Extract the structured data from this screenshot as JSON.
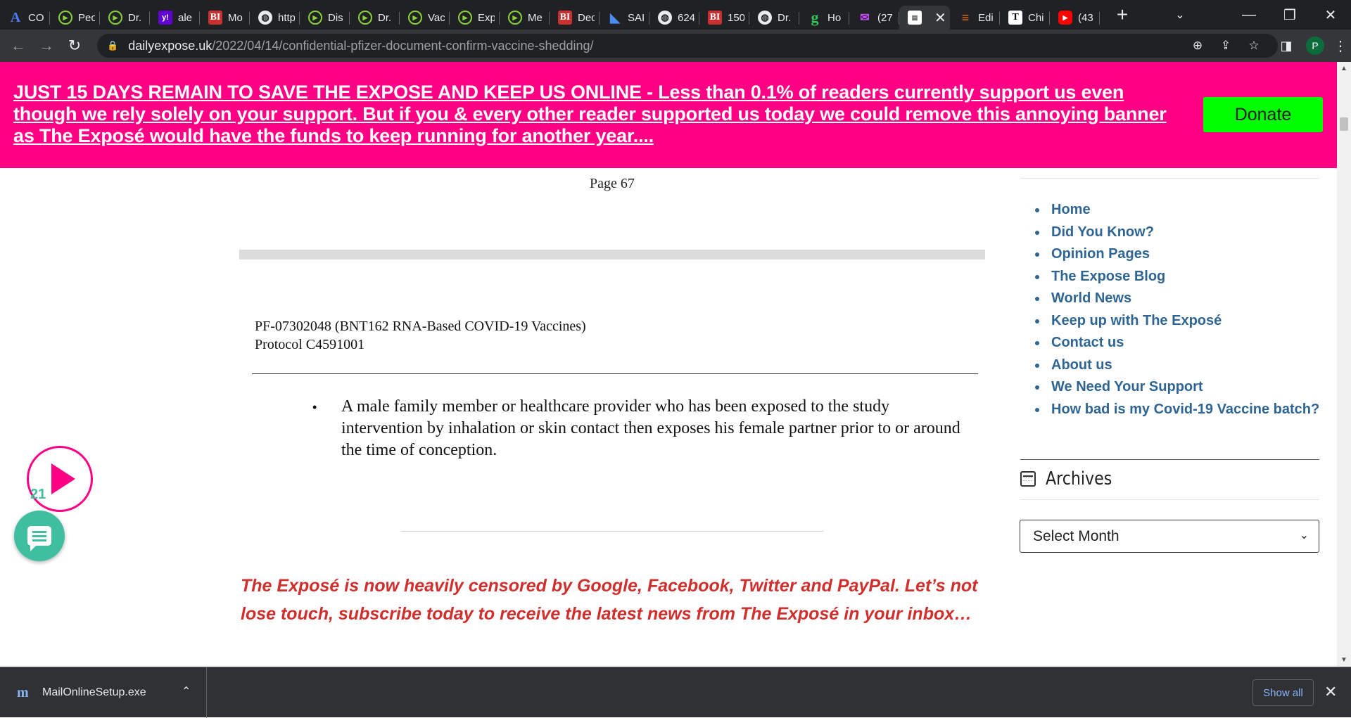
{
  "tabs": [
    {
      "label": "CO",
      "icon": "atlas-icon",
      "glyph": "A"
    },
    {
      "label": "Peo",
      "icon": "play-icon",
      "glyph": "▶"
    },
    {
      "label": "Dr.",
      "icon": "play-icon",
      "glyph": "▶"
    },
    {
      "label": "ale",
      "icon": "yahoo-icon",
      "glyph": "y!"
    },
    {
      "label": "Mo",
      "icon": "bi-icon",
      "glyph": "BI"
    },
    {
      "label": "http",
      "icon": "globe-icon",
      "glyph": "◍"
    },
    {
      "label": "Dis",
      "icon": "play-icon",
      "glyph": "▶"
    },
    {
      "label": "Dr.",
      "icon": "play-icon",
      "glyph": "▶"
    },
    {
      "label": "Vac",
      "icon": "play-icon",
      "glyph": "▶"
    },
    {
      "label": "Exp",
      "icon": "play-icon",
      "glyph": "▶"
    },
    {
      "label": "Me",
      "icon": "play-icon",
      "glyph": "▶"
    },
    {
      "label": "Dec",
      "icon": "bi-icon",
      "glyph": "BI"
    },
    {
      "label": "SAI",
      "icon": "sap-icon",
      "glyph": "◣"
    },
    {
      "label": "624",
      "icon": "globe-icon",
      "glyph": "◍"
    },
    {
      "label": "150",
      "icon": "bi-icon",
      "glyph": "BI"
    },
    {
      "label": "Dr.",
      "icon": "globe-icon",
      "glyph": "◍"
    },
    {
      "label": "Ho",
      "icon": "g-icon",
      "glyph": "g"
    },
    {
      "label": "(27",
      "icon": "mail-icon",
      "glyph": "✉"
    },
    {
      "label": "",
      "icon": "document-icon",
      "glyph": "▤",
      "active": true,
      "close": "✕"
    },
    {
      "label": "Edi",
      "icon": "edi-icon",
      "glyph": "≡"
    },
    {
      "label": "Chi",
      "icon": "t-icon",
      "glyph": "T"
    },
    {
      "label": "(43",
      "icon": "youtube-icon",
      "glyph": "▶"
    }
  ],
  "window": {
    "new_tab": "+",
    "tab_search": "⌄",
    "minimize": "—",
    "restore": "❐",
    "close": "✕"
  },
  "toolbar": {
    "back": "←",
    "forward": "→",
    "reload": "↻",
    "lock": "🔒",
    "url_host": "dailyexpose.uk",
    "url_path": "/2022/04/14/confidential-pfizer-document-confirm-vaccine-shedding/",
    "zoom": "⊕",
    "share": "⇪",
    "bookmark": "☆",
    "side_panel": "◨",
    "avatar": "P",
    "menu": "⋮"
  },
  "banner": {
    "text": "JUST 15 DAYS REMAIN TO SAVE THE EXPOSE AND KEEP US ONLINE - Less than 0.1% of readers currently support us even though we rely solely on your support. But if you & every other reader supported us today we could remove this annoying banner as The Exposé would have the funds to keep running for another year....",
    "donate_label": "Donate",
    "color": "#ff0084",
    "donate_color": "#00ff00"
  },
  "document": {
    "page_number": "Page 67",
    "header_line1": "PF-07302048 (BNT162 RNA-Based COVID-19 Vaccines)",
    "header_line2": "Protocol C4591001",
    "bullet_symbol": "•",
    "bullet_text": "A male family member or healthcare provider who has been exposed to the study intervention by inhalation or skin contact then exposes his female partner prior to or around the time of conception."
  },
  "article": {
    "censorship_notice": "The Exposé is now heavily censored by Google, Facebook, Twitter and PayPal. Let’s not lose touch, subscribe today to receive the latest news from The Exposé in your inbox…",
    "notice_color": "#d0302d"
  },
  "sidebar": {
    "menu": [
      "Home",
      "Did You Know?",
      "Opinion Pages",
      "The Expose Blog",
      "World News",
      "Keep up with The Exposé",
      "Contact us",
      "About us",
      "We Need Your Support",
      "How bad is my Covid-19 Vaccine batch?"
    ],
    "archives_title": "Archives",
    "archives_select": "Select Month",
    "link_color": "#2f6593"
  },
  "floating": {
    "play_count": "21",
    "accent": "#3fbf9f"
  },
  "scrollbar": {
    "up": "▲",
    "down": "▼"
  },
  "downloads": {
    "file_name": "MailOnlineSetup.exe",
    "file_icon": "m",
    "caret": "⌃",
    "show_all": "Show all",
    "close": "✕"
  }
}
